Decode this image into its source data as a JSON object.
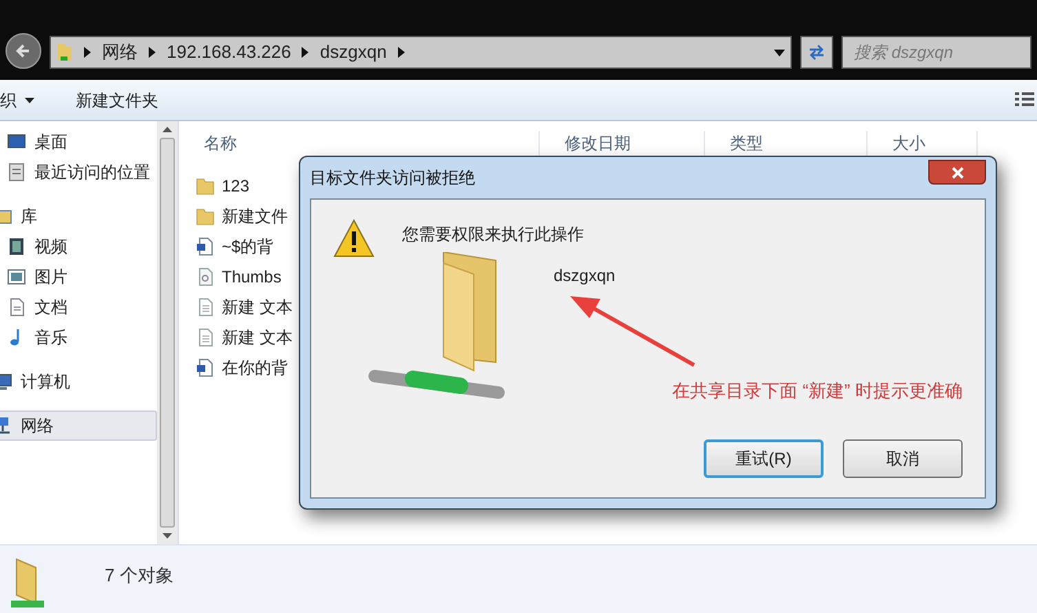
{
  "address_bar": {
    "crumbs": [
      "网络",
      "192.168.43.226",
      "dszgxqn"
    ]
  },
  "search": {
    "placeholder": "搜索 dszgxqn"
  },
  "toolbar": {
    "items": [
      {
        "label": "织",
        "kind": "menu"
      },
      {
        "label": "新建文件夹",
        "kind": "plain"
      }
    ]
  },
  "sidebar": {
    "items": [
      {
        "label": "桌面",
        "kind": "desktop",
        "selected": false
      },
      {
        "label": "最近访问的位置",
        "kind": "recent",
        "selected": false
      },
      {
        "label": "库",
        "kind": "library",
        "selected": false
      },
      {
        "label": "视频",
        "kind": "video",
        "selected": false
      },
      {
        "label": "图片",
        "kind": "picture",
        "selected": false
      },
      {
        "label": "文档",
        "kind": "document",
        "selected": false
      },
      {
        "label": "音乐",
        "kind": "music",
        "selected": false
      },
      {
        "label": "计算机",
        "kind": "computer",
        "selected": false
      },
      {
        "label": "网络",
        "kind": "network",
        "selected": true
      }
    ]
  },
  "table": {
    "columns": [
      "名称",
      "修改日期",
      "类型",
      "大小"
    ],
    "rows": [
      {
        "name": "123",
        "kind": "folder"
      },
      {
        "name": "新建文件",
        "kind": "folder"
      },
      {
        "name": "~$的背",
        "kind": "word"
      },
      {
        "name": "Thumbs",
        "kind": "system"
      },
      {
        "name": "新建 文本",
        "kind": "text"
      },
      {
        "name": "新建 文本",
        "kind": "text"
      },
      {
        "name": "在你的背",
        "kind": "word"
      }
    ]
  },
  "dialog": {
    "title": "目标文件夹访问被拒绝",
    "message": "您需要权限来执行此操作",
    "folder_name": "dszgxqn",
    "annotation": "在共享目录下面 “新建” 时提示更准确",
    "buttons": [
      {
        "label": "重试(R)",
        "selected": true
      },
      {
        "label": "取消",
        "selected": false
      }
    ]
  },
  "status_bar": {
    "count": "7 个对象"
  }
}
